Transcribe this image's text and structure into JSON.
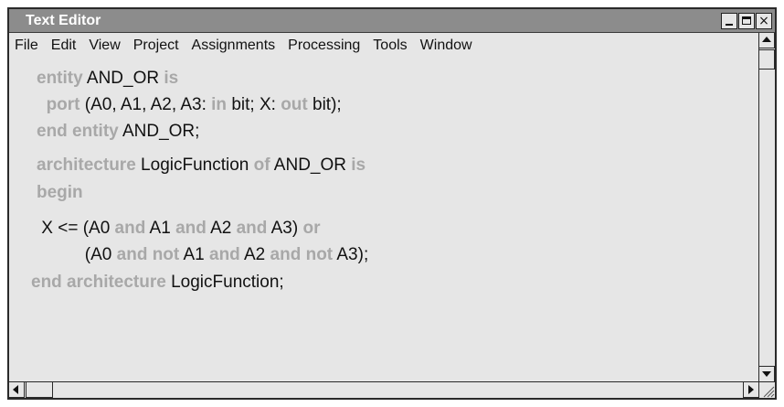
{
  "window": {
    "title": "Text Editor",
    "controls": {
      "minimize": "_",
      "maximize": "□",
      "close": "×"
    }
  },
  "menu": {
    "items": [
      "File",
      "Edit",
      "View",
      "Project",
      "Assignments",
      "Processing",
      "Tools",
      "Window"
    ]
  },
  "editor": {
    "lines": [
      [
        {
          "t": "entity",
          "k": true
        },
        {
          "t": " AND_OR ",
          "k": false
        },
        {
          "t": "is",
          "k": true
        }
      ],
      [
        {
          "t": "  ",
          "k": false
        },
        {
          "t": "port",
          "k": true
        },
        {
          "t": " (A0, A1, A2, A3: ",
          "k": false
        },
        {
          "t": "in",
          "k": true
        },
        {
          "t": " bit; X: ",
          "k": false
        },
        {
          "t": "out",
          "k": true
        },
        {
          "t": " bit);",
          "k": false
        }
      ],
      [
        {
          "t": "end entity",
          "k": true
        },
        {
          "t": " AND_OR;",
          "k": false
        }
      ],
      [
        {
          "t": "architecture",
          "k": true
        },
        {
          "t": " LogicFunction ",
          "k": false
        },
        {
          "t": "of",
          "k": true
        },
        {
          "t": " AND_OR ",
          "k": false
        },
        {
          "t": "is",
          "k": true
        }
      ],
      [
        {
          "t": "begin",
          "k": true
        }
      ],
      [
        {
          "t": " X <= (A0 ",
          "k": false
        },
        {
          "t": "and",
          "k": true
        },
        {
          "t": " A1 ",
          "k": false
        },
        {
          "t": "and",
          "k": true
        },
        {
          "t": " A2 ",
          "k": false
        },
        {
          "t": "and",
          "k": true
        },
        {
          "t": " A3) ",
          "k": false
        },
        {
          "t": "or",
          "k": true
        }
      ],
      [
        {
          "t": "          (A0 ",
          "k": false
        },
        {
          "t": "and not",
          "k": true
        },
        {
          "t": " A1 ",
          "k": false
        },
        {
          "t": "and",
          "k": true
        },
        {
          "t": " A2 ",
          "k": false
        },
        {
          "t": "and not",
          "k": true
        },
        {
          "t": " A3);",
          "k": false
        }
      ],
      [
        {
          "t": "end architecture",
          "k": true
        },
        {
          "t": " LogicFunction;",
          "k": false
        }
      ]
    ]
  },
  "colors": {
    "keyword": "#a8a8a8",
    "text": "#111111",
    "titlebar": "#8c8c8c",
    "background": "#e6e6e6"
  },
  "icons": [
    "minimize-icon",
    "maximize-icon",
    "close-icon",
    "scroll-up-arrow-icon",
    "scroll-down-arrow-icon",
    "scroll-left-arrow-icon",
    "scroll-right-arrow-icon",
    "resize-grip-icon"
  ]
}
